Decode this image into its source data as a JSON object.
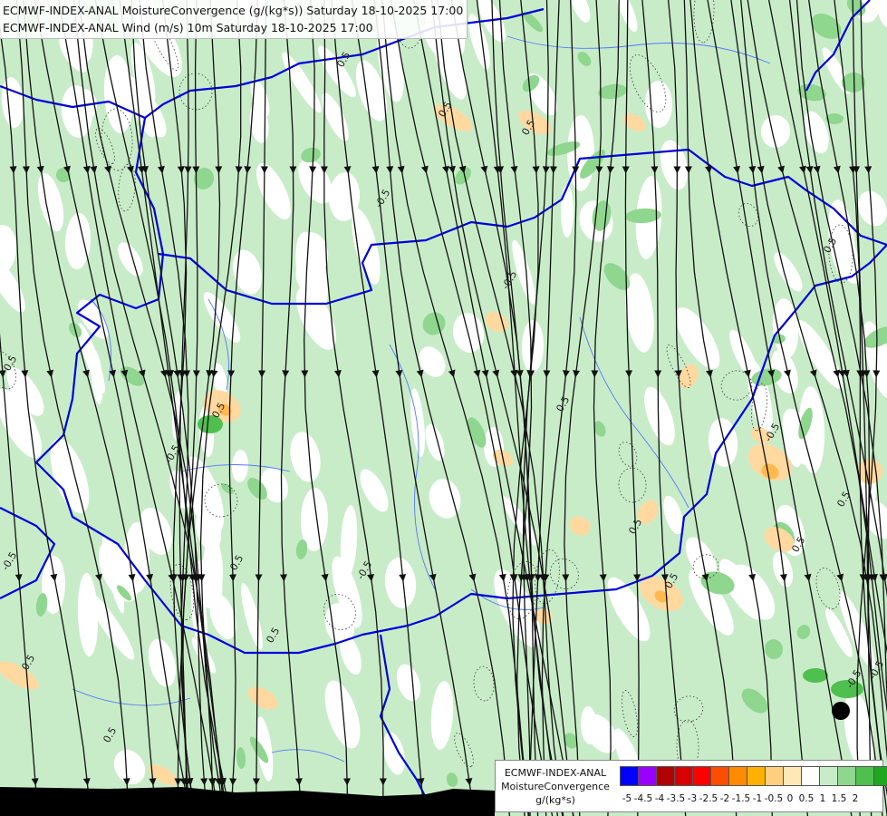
{
  "title_lines": [
    "ECMWF-INDEX-ANAL MoistureConvergence (g/(kg*s)) Saturday 18-10-2025 17:00",
    "ECMWF-INDEX-ANAL Wind (m/s) 10m Saturday 18-10-2025 17:00"
  ],
  "legend": {
    "model": "ECMWF-INDEX-ANAL",
    "parameter": "MoistureConvergence",
    "unit": "g/(kg*s)",
    "ticks": [
      "-5",
      "-4.5",
      "-4",
      "-3.5",
      "-3",
      "-2.5",
      "-2",
      "-1.5",
      "-1",
      "-0.5",
      "0",
      "0.5",
      "1",
      "1.5",
      "2"
    ],
    "colors": [
      "#0000ff",
      "#9a00ff",
      "#b00000",
      "#d80000",
      "#ff0000",
      "#ff4d00",
      "#ff8c00",
      "#ffb000",
      "#ffd080",
      "#ffe8b8",
      "#ffffff",
      "#c8ecc8",
      "#8fd68f",
      "#4fbf4f",
      "#1fa81f"
    ]
  },
  "contour_labels": [
    "0.5",
    "0.5",
    "0.5",
    "0.5",
    "-0.5",
    "-0.5",
    "0.5",
    "0.5",
    "0.5",
    "0.5",
    "-0.5",
    "0.5",
    "-0.5",
    "0.5",
    "-0.5",
    "0.5",
    "-0.5",
    "0.5",
    "-0.5",
    "0.5",
    "-0.5",
    "0.5",
    "0.5",
    "-0.5"
  ],
  "colors": {
    "border": "#0000dd",
    "river": "#5577ff",
    "streamline": "#111111",
    "land_mask": "#000000"
  }
}
